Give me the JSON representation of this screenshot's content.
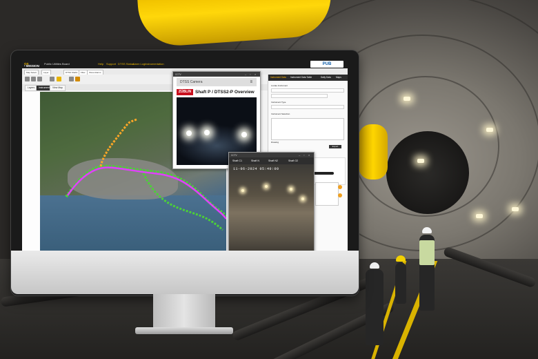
{
  "app": {
    "logo_prefix": "• MISSION",
    "logo_suffix": "OS",
    "subtitle": "Public Utilities Board",
    "nav": [
      "Help",
      "Support",
      "DTSS Status",
      "Alarm Log",
      "Instrumentation"
    ],
    "partner_logo": "PUB"
  },
  "toolbar": {
    "buttons": [
      "Map Select",
      "Layer",
      "DTSS Shafts",
      "Filter",
      "Show Alarms"
    ]
  },
  "tabs": [
    "Layers",
    "Instruments",
    "View Map"
  ],
  "right_panel": {
    "tabs": [
      "Instrument Data",
      "Instrument Data Table",
      "Daily Data",
      "Maps"
    ],
    "labels": [
      "Locate Instrument",
      "Instrument Type",
      "Instrument Selection",
      "Drawing"
    ],
    "button": "Export",
    "chart_title": "Movement Level Range 14 Days"
  },
  "cctv_window": {
    "window_title": "CCTV",
    "header": "DTSS Camera",
    "brand": "ZÜBLIN",
    "title": "Shaft P / DTSS2-P Overview"
  },
  "multi_window": {
    "window_title": "CCTV",
    "tabs": [
      "Shaft C1",
      "Shaft N",
      "Shaft N2",
      "Shaft O2"
    ],
    "timestamp": "11-06-2024  05:40:00"
  },
  "colors": {
    "accent": "#e8b400",
    "route_green": "#4cd137",
    "route_magenta": "#e040fb",
    "route_orange": "#ffa726"
  }
}
